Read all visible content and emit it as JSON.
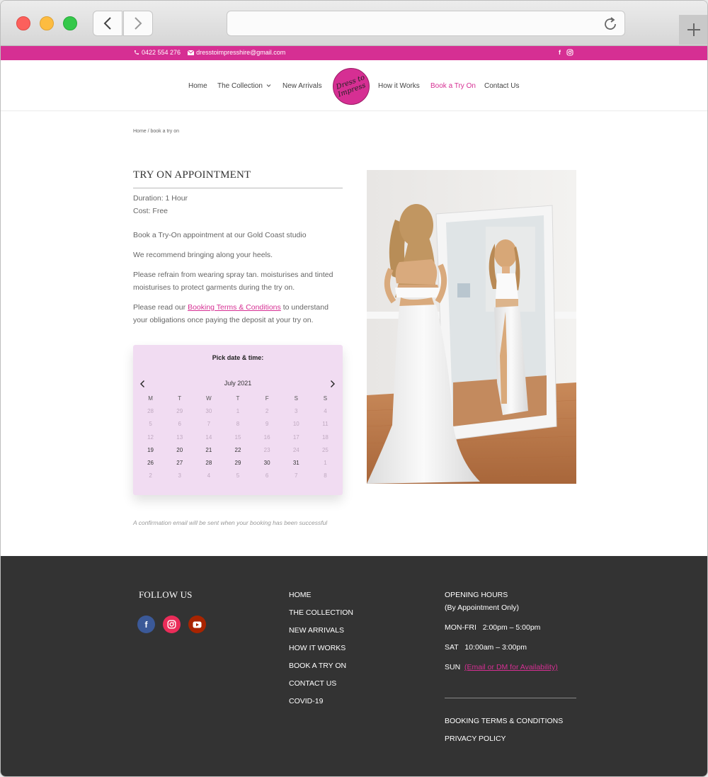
{
  "topbar": {
    "phone": "0422 554 276",
    "email": "dresstoimpresshire@gmail.com"
  },
  "nav": {
    "items": [
      "Home",
      "The Collection",
      "New Arrivals",
      "How it Works",
      "Book a Try On",
      "Contact Us"
    ],
    "logo_line1": "Dress to",
    "logo_line2": "Impress"
  },
  "breadcrumb": "Home / book a try on",
  "appointment": {
    "title": "TRY ON APPOINTMENT",
    "duration": "Duration: 1 Hour",
    "cost": "Cost: Free",
    "p1": "Book a Try-On appointment at our Gold Coast studio",
    "p2": "We recommend bringing along your heels.",
    "p3": "Please refrain from wearing spray tan. moisturises and tinted moisturises to protect garments during the try on.",
    "p4_before": "Please read our ",
    "p4_link": "Booking Terms & Conditions",
    "p4_after": " to understand your obligations once paying the deposit at your try on."
  },
  "calendar": {
    "heading": "Pick date & time:",
    "month": "July 2021",
    "weekdays": [
      "M",
      "T",
      "W",
      "T",
      "F",
      "S",
      "S"
    ],
    "days": [
      [
        "28",
        "29",
        "30",
        "1",
        "2",
        "3",
        "4"
      ],
      [
        "5",
        "6",
        "7",
        "8",
        "9",
        "10",
        "11"
      ],
      [
        "12",
        "13",
        "14",
        "15",
        "16",
        "17",
        "18"
      ],
      [
        "19",
        "20",
        "21",
        "22",
        "23",
        "24",
        "25"
      ],
      [
        "26",
        "27",
        "28",
        "29",
        "30",
        "31",
        "1"
      ],
      [
        "2",
        "3",
        "4",
        "5",
        "6",
        "7",
        "8"
      ]
    ],
    "available": [
      [
        3,
        0
      ],
      [
        3,
        1
      ],
      [
        3,
        2
      ],
      [
        3,
        3
      ],
      [
        4,
        0
      ],
      [
        4,
        1
      ],
      [
        4,
        2
      ],
      [
        4,
        3
      ],
      [
        4,
        4
      ],
      [
        4,
        5
      ]
    ]
  },
  "confirmation": "A confirmation email will be sent when your booking has been successful",
  "footer": {
    "follow": "FOLLOW US",
    "menu": [
      "HOME",
      "THE COLLECTION",
      "NEW ARRIVALS",
      "HOW IT WORKS",
      "BOOK A TRY ON",
      "CONTACT US",
      "COVID-19"
    ],
    "hours_title": "OPENING HOURS",
    "hours_sub": "(By Appointment Only)",
    "monfri_day": "MON-FRI",
    "monfri_time": "2:00pm – 5:00pm",
    "sat_day": "SAT",
    "sat_time": "10:00am – 3:00pm",
    "sun_day": "SUN",
    "sun_link": "(Email or DM for Availability)",
    "terms": "BOOKING TERMS & CONDITIONS",
    "privacy": "PRIVACY POLICY"
  },
  "colors": {
    "brand_pink": "#d62f93",
    "calendar_bg": "#f1dcf2",
    "footer_bg": "#333333"
  },
  "icons": [
    "back-arrow-icon",
    "forward-arrow-icon",
    "reload-icon",
    "new-tab-plus-icon",
    "phone-icon",
    "email-icon",
    "facebook-icon",
    "instagram-icon",
    "youtube-icon",
    "chevron-down-icon",
    "chevron-left-icon",
    "chevron-right-icon"
  ]
}
